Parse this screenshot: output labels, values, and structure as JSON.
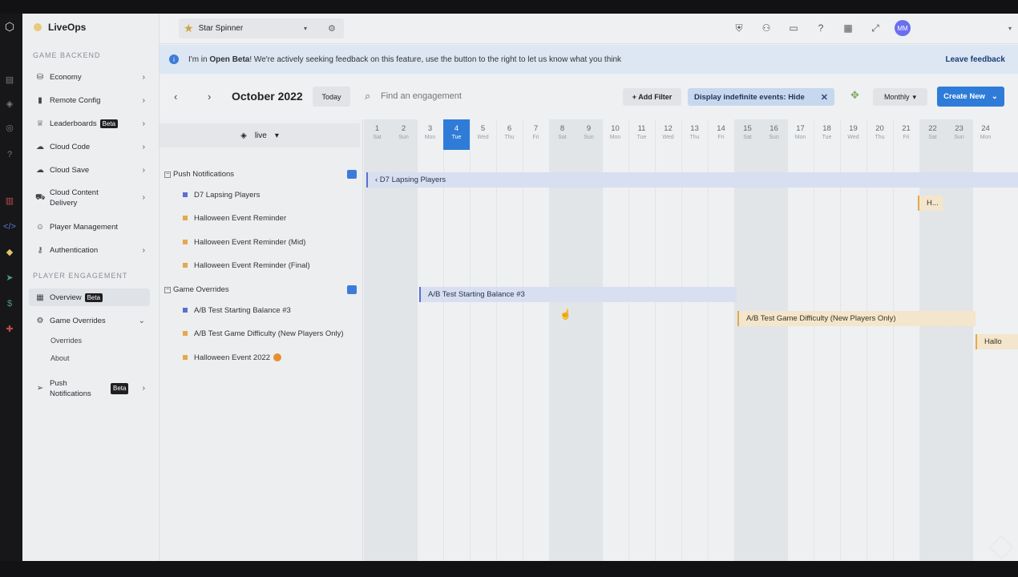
{
  "app": {
    "name": "LiveOps"
  },
  "sidebar": {
    "sections": [
      {
        "title": "GAME BACKEND"
      },
      {
        "title": "PLAYER ENGAGEMENT"
      }
    ],
    "items": [
      {
        "label": "Economy"
      },
      {
        "label": "Remote Config"
      },
      {
        "label": "Leaderboards",
        "badge": "Beta"
      },
      {
        "label": "Cloud Code"
      },
      {
        "label": "Cloud Save"
      },
      {
        "label": "Cloud Content Delivery"
      },
      {
        "label": "Player Management"
      },
      {
        "label": "Authentication"
      },
      {
        "label": "Overview",
        "badge": "Beta"
      },
      {
        "label": "Game Overrides"
      },
      {
        "label": "Push Notifications",
        "badge": "Beta"
      }
    ],
    "subitems": [
      {
        "label": "Overrides"
      },
      {
        "label": "About"
      }
    ]
  },
  "topbar": {
    "project": "Star Spinner",
    "avatar_initials": "MM"
  },
  "banner": {
    "prefix": "I'm in ",
    "bold": "Open Beta",
    "text": "! We're actively seeking feedback on this feature, use the button to the right to let us know what you think",
    "action": "Leave feedback"
  },
  "toolbar": {
    "month": "October 2022",
    "today": "Today",
    "search_placeholder": "Find an engagement",
    "add_filter": "+ Add Filter",
    "chip": "Display indefinite events: Hide",
    "view": "Monthly",
    "create": "Create New"
  },
  "list": {
    "environment": "live",
    "groups": [
      {
        "title": "Push Notifications",
        "count": ""
      },
      {
        "title": "Game Overrides",
        "count": ""
      }
    ],
    "rows": [
      {
        "label": "D7 Lapsing Players",
        "color": "#5c6fd0"
      },
      {
        "label": "Halloween Event Reminder",
        "color": "#e5a84a"
      },
      {
        "label": "Halloween Event Reminder (Mid)",
        "color": "#e5a84a"
      },
      {
        "label": "Halloween Event Reminder (Final)",
        "color": "#e5a84a"
      },
      {
        "label": "A/B Test Starting Balance #3",
        "color": "#5c6fd0"
      },
      {
        "label": "A/B Test Game Difficulty (New Players Only)",
        "color": "#e5a84a"
      },
      {
        "label": "Halloween Event 2022",
        "color": "#e5a84a"
      }
    ]
  },
  "calendar": {
    "days": [
      {
        "num": "1",
        "name": "Sat",
        "weekend": true
      },
      {
        "num": "2",
        "name": "Sun",
        "weekend": true
      },
      {
        "num": "3",
        "name": "Mon",
        "weekend": false
      },
      {
        "num": "4",
        "name": "Tue",
        "weekend": false,
        "today": true
      },
      {
        "num": "5",
        "name": "Wed",
        "weekend": false
      },
      {
        "num": "6",
        "name": "Thu",
        "weekend": false
      },
      {
        "num": "7",
        "name": "Fri",
        "weekend": false
      },
      {
        "num": "8",
        "name": "Sat",
        "weekend": true
      },
      {
        "num": "9",
        "name": "Sun",
        "weekend": true
      },
      {
        "num": "10",
        "name": "Mon",
        "weekend": false
      },
      {
        "num": "11",
        "name": "Tue",
        "weekend": false
      },
      {
        "num": "12",
        "name": "Wed",
        "weekend": false
      },
      {
        "num": "13",
        "name": "Thu",
        "weekend": false
      },
      {
        "num": "14",
        "name": "Fri",
        "weekend": false
      },
      {
        "num": "15",
        "name": "Sat",
        "weekend": true
      },
      {
        "num": "16",
        "name": "Sun",
        "weekend": true
      },
      {
        "num": "17",
        "name": "Mon",
        "weekend": false
      },
      {
        "num": "18",
        "name": "Tue",
        "weekend": false
      },
      {
        "num": "19",
        "name": "Wed",
        "weekend": false
      },
      {
        "num": "20",
        "name": "Thu",
        "weekend": false
      },
      {
        "num": "21",
        "name": "Fri",
        "weekend": false
      },
      {
        "num": "22",
        "name": "Sat",
        "weekend": true
      },
      {
        "num": "23",
        "name": "Sun",
        "weekend": true
      },
      {
        "num": "24",
        "name": "Mon",
        "weekend": false
      }
    ],
    "events": [
      {
        "label": "‹ D7 Lapsing Players",
        "type": "blue"
      },
      {
        "label": "H...",
        "type": "orange"
      },
      {
        "label": "A/B Test Starting Balance #3",
        "type": "blue"
      },
      {
        "label": "A/B Test Game Difficulty (New Players Only)",
        "type": "orange"
      },
      {
        "label": "Hallo",
        "type": "orange"
      }
    ]
  }
}
